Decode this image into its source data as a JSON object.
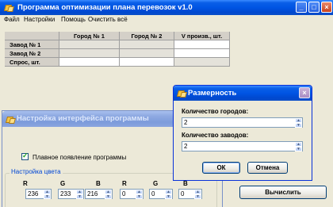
{
  "main": {
    "title": "Программа оптимизации плана перевозок v1.0",
    "menu": [
      "Файл",
      "Настройки",
      "Помощь",
      "Очистить всё"
    ],
    "table": {
      "columns": [
        "",
        "Город № 1",
        "Город № 2",
        "V произв., шт."
      ],
      "rows": [
        "Завод № 1",
        "Завод № 2",
        "Спрос, шт."
      ]
    },
    "compute_label": "Вычислить",
    "controls": {
      "minimize": "_",
      "maximize": "□",
      "close": "×"
    }
  },
  "settings": {
    "title": "Настройка интерфейса программы",
    "smooth_label": "Плавное появление программы",
    "smooth_checked": true,
    "color_group_label": "Настройка цвета",
    "rgb_labels": [
      "R",
      "G",
      "B",
      "R",
      "G",
      "B"
    ],
    "rgb_values": [
      "236",
      "233",
      "216",
      "0",
      "0",
      "0"
    ]
  },
  "size_dialog": {
    "title": "Размерность",
    "cities_label": "Количество городов:",
    "cities_value": "2",
    "plants_label": "Количество заводов:",
    "plants_value": "2",
    "ok_label": "ОК",
    "cancel_label": "Отмена",
    "close_glyph": "×"
  },
  "colors": {
    "titlebar_active": "#0054e3",
    "titlebar_inactive": "#7d9bdb",
    "window_bg": "#ece9d8",
    "close_button": "#c8421d"
  }
}
